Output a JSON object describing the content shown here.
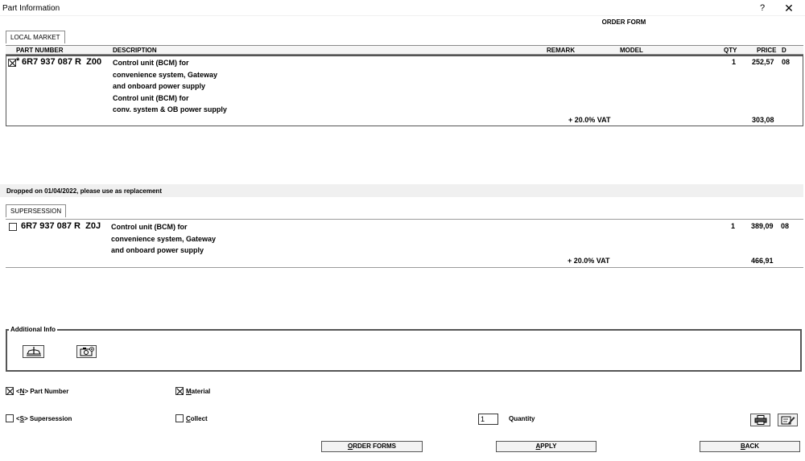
{
  "window": {
    "title": "Part Information",
    "help": "?",
    "close": "✕"
  },
  "form_title": "ORDER FORM",
  "tabs": {
    "local_market": "LOCAL MARKET",
    "supersession": "SUPERSESSION"
  },
  "columns": {
    "part_number": "PART NUMBER",
    "description": "DESCRIPTION",
    "remark": "REMARK",
    "model": "MODEL",
    "qty": "QTY",
    "price": "PRICE",
    "d": "D"
  },
  "main_part": {
    "checked": true,
    "marker": "*",
    "part_number": "6R7 937 087 R  Z00",
    "description": [
      "Control unit (BCM) for",
      "convenience system, Gateway",
      "and onboard power supply",
      "Control unit (BCM) for",
      "conv. system & OB power supply"
    ],
    "qty": "1",
    "price": "252,57",
    "d": "08",
    "vat_label": "+ 20.0% VAT",
    "vat_price": "303,08"
  },
  "dropped_notice": "Dropped on 01/04/2022, please use as replacement",
  "supersession_part": {
    "checked": false,
    "part_number": "6R7 937 087 R  Z0J",
    "description": [
      "Control unit (BCM) for",
      "convenience system, Gateway",
      "and onboard power supply"
    ],
    "qty": "1",
    "price": "389,09",
    "d": "08",
    "vat_label": "+ 20.0% VAT",
    "vat_price": "466,91"
  },
  "additional_info": {
    "legend": "Additional Info",
    "icons": [
      "car-lift-icon",
      "camera-icon"
    ]
  },
  "options": {
    "part_number": {
      "checked": true,
      "prefix": "<",
      "key": "N",
      "suffix": "> Part Number"
    },
    "material": {
      "checked": true,
      "key": "M",
      "rest": "aterial"
    },
    "supersession": {
      "checked": false,
      "prefix": "<",
      "key": "S",
      "suffix": "> Supersession"
    },
    "collect": {
      "checked": false,
      "key": "C",
      "rest": "ollect"
    }
  },
  "quantity": {
    "value": "1",
    "label": "Quantity"
  },
  "buttons": {
    "order_forms": {
      "key": "O",
      "rest": "RDER FORMS"
    },
    "apply": {
      "key": "A",
      "rest": "PPLY"
    },
    "back": {
      "key": "B",
      "rest": "ACK"
    }
  }
}
